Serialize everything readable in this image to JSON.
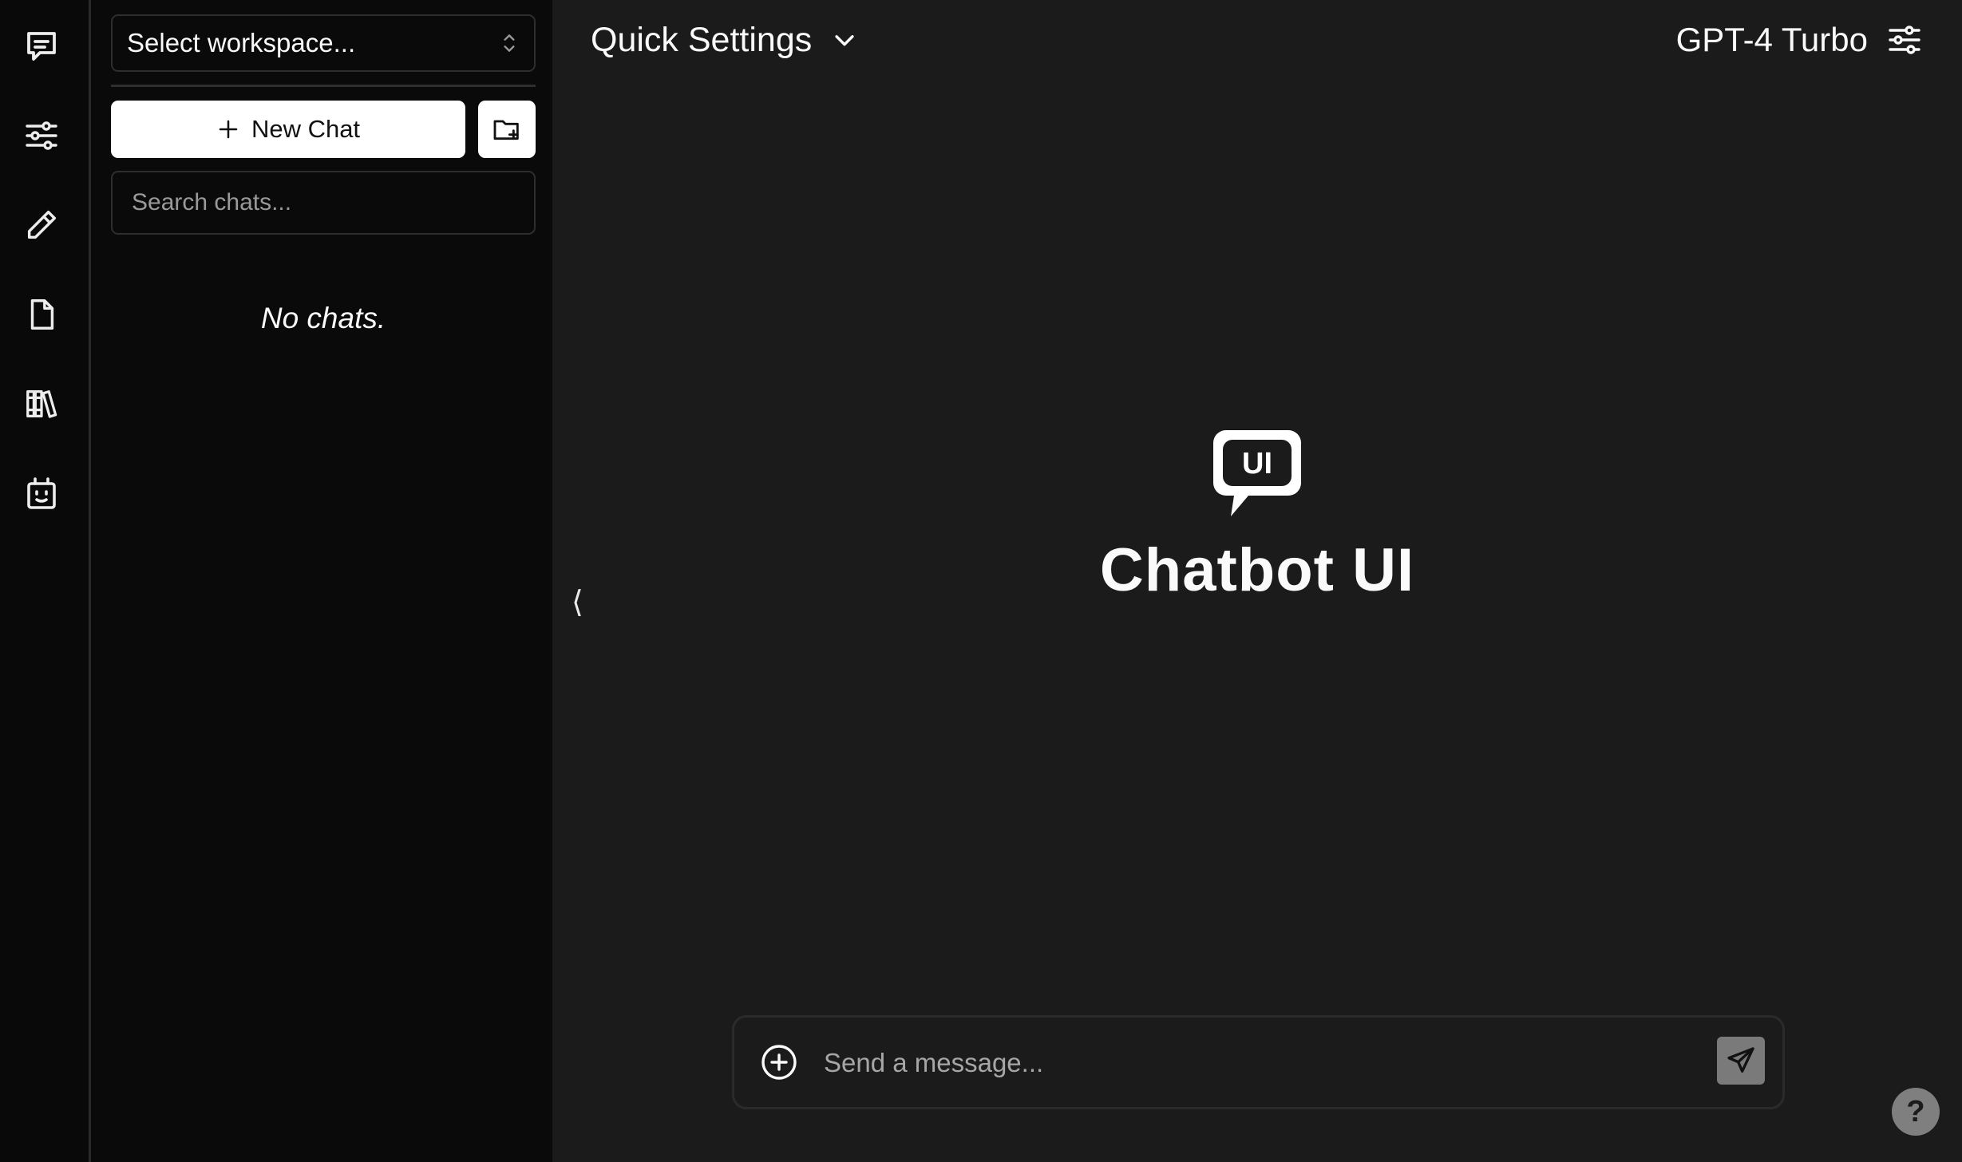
{
  "rail": {
    "items": [
      {
        "name": "chats",
        "icon": "message-square-icon"
      },
      {
        "name": "presets",
        "icon": "sliders-icon"
      },
      {
        "name": "prompts",
        "icon": "pencil-icon"
      },
      {
        "name": "files",
        "icon": "file-icon"
      },
      {
        "name": "collections",
        "icon": "books-icon"
      },
      {
        "name": "assistants",
        "icon": "robot-face-icon"
      }
    ]
  },
  "sidebar": {
    "workspace_placeholder": "Select workspace...",
    "new_chat_label": "New Chat",
    "search_placeholder": "Search chats...",
    "empty_label": "No chats."
  },
  "header": {
    "quick_settings_label": "Quick Settings",
    "model_label": "GPT-4 Turbo"
  },
  "collapse_glyph": "⟨",
  "brand": {
    "logo_text": "UI",
    "title": "Chatbot UI"
  },
  "composer": {
    "placeholder": "Send a message..."
  },
  "help_label": "?",
  "colors": {
    "background": "#1b1b1b",
    "sidebar": "#0a0a0a",
    "rail": "#090909",
    "button_light": "#ffffff",
    "send_button": "#7a7a7a"
  }
}
